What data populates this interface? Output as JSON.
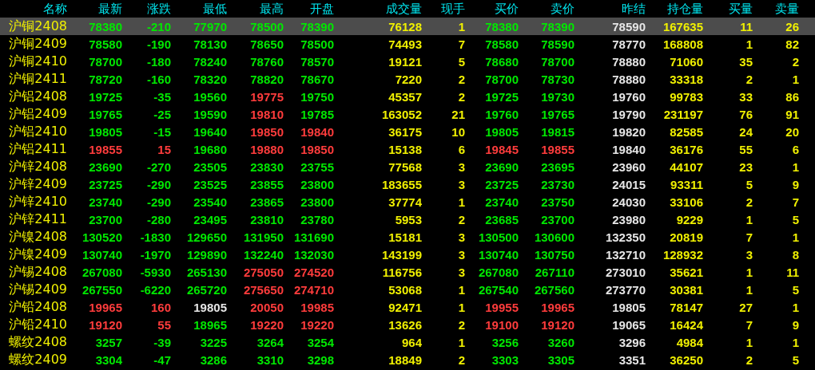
{
  "columns": [
    "名称",
    "最新",
    "涨跌",
    "最低",
    "最高",
    "开盘",
    "成交量",
    "现手",
    "买价",
    "卖价",
    "昨结",
    "持仓量",
    "买量",
    "卖量"
  ],
  "rows": [
    {
      "selected": true,
      "cells": [
        "沪铜2408",
        "78380",
        "-210",
        "77970",
        "78500",
        "78390",
        "76128",
        "1",
        "78380",
        "78390",
        "78590",
        "167635",
        "11",
        "26"
      ]
    },
    {
      "selected": false,
      "cells": [
        "沪铜2409",
        "78580",
        "-190",
        "78130",
        "78650",
        "78500",
        "74493",
        "7",
        "78580",
        "78590",
        "78770",
        "168808",
        "1",
        "82"
      ]
    },
    {
      "selected": false,
      "cells": [
        "沪铜2410",
        "78700",
        "-180",
        "78240",
        "78760",
        "78570",
        "19121",
        "5",
        "78680",
        "78700",
        "78880",
        "71060",
        "35",
        "2"
      ]
    },
    {
      "selected": false,
      "cells": [
        "沪铜2411",
        "78720",
        "-160",
        "78320",
        "78820",
        "78670",
        "7220",
        "2",
        "78700",
        "78730",
        "78880",
        "33318",
        "2",
        "1"
      ]
    },
    {
      "selected": false,
      "cells": [
        "沪铝2408",
        "19725",
        "-35",
        "19560",
        "19775",
        "19750",
        "45357",
        "2",
        "19725",
        "19730",
        "19760",
        "99783",
        "33",
        "86"
      ]
    },
    {
      "selected": false,
      "cells": [
        "沪铝2409",
        "19765",
        "-25",
        "19590",
        "19810",
        "19785",
        "163052",
        "21",
        "19760",
        "19765",
        "19790",
        "231197",
        "76",
        "91"
      ]
    },
    {
      "selected": false,
      "cells": [
        "沪铝2410",
        "19805",
        "-15",
        "19640",
        "19850",
        "19840",
        "36175",
        "10",
        "19805",
        "19815",
        "19820",
        "82585",
        "24",
        "20"
      ]
    },
    {
      "selected": false,
      "cells": [
        "沪铝2411",
        "19855",
        "15",
        "19680",
        "19880",
        "19850",
        "15138",
        "6",
        "19845",
        "19855",
        "19840",
        "36176",
        "55",
        "6"
      ]
    },
    {
      "selected": false,
      "cells": [
        "沪锌2408",
        "23690",
        "-270",
        "23505",
        "23830",
        "23755",
        "77568",
        "3",
        "23690",
        "23695",
        "23960",
        "44107",
        "23",
        "1"
      ]
    },
    {
      "selected": false,
      "cells": [
        "沪锌2409",
        "23725",
        "-290",
        "23525",
        "23855",
        "23800",
        "183655",
        "3",
        "23725",
        "23730",
        "24015",
        "93311",
        "5",
        "9"
      ]
    },
    {
      "selected": false,
      "cells": [
        "沪锌2410",
        "23740",
        "-290",
        "23540",
        "23865",
        "23800",
        "37774",
        "1",
        "23740",
        "23750",
        "24030",
        "33106",
        "2",
        "7"
      ]
    },
    {
      "selected": false,
      "cells": [
        "沪锌2411",
        "23700",
        "-280",
        "23495",
        "23810",
        "23780",
        "5953",
        "2",
        "23685",
        "23700",
        "23980",
        "9229",
        "1",
        "5"
      ]
    },
    {
      "selected": false,
      "cells": [
        "沪镍2408",
        "130520",
        "-1830",
        "129650",
        "131950",
        "131690",
        "15181",
        "3",
        "130500",
        "130600",
        "132350",
        "20819",
        "7",
        "1"
      ]
    },
    {
      "selected": false,
      "cells": [
        "沪镍2409",
        "130740",
        "-1970",
        "129890",
        "132240",
        "132030",
        "143199",
        "3",
        "130740",
        "130750",
        "132710",
        "128932",
        "3",
        "8"
      ]
    },
    {
      "selected": false,
      "cells": [
        "沪锡2408",
        "267080",
        "-5930",
        "265130",
        "275050",
        "274520",
        "116756",
        "3",
        "267080",
        "267110",
        "273010",
        "35621",
        "1",
        "11"
      ]
    },
    {
      "selected": false,
      "cells": [
        "沪锡2409",
        "267550",
        "-6220",
        "265720",
        "275650",
        "274710",
        "53068",
        "1",
        "267540",
        "267560",
        "273770",
        "30381",
        "1",
        "5"
      ]
    },
    {
      "selected": false,
      "cells": [
        "沪铅2408",
        "19965",
        "160",
        "19805",
        "20050",
        "19985",
        "92471",
        "1",
        "19955",
        "19965",
        "19805",
        "78147",
        "27",
        "1"
      ]
    },
    {
      "selected": false,
      "cells": [
        "沪铅2410",
        "19120",
        "55",
        "18965",
        "19220",
        "19220",
        "13626",
        "2",
        "19100",
        "19120",
        "19065",
        "16424",
        "7",
        "9"
      ]
    },
    {
      "selected": false,
      "cells": [
        "螺纹2408",
        "3257",
        "-39",
        "3225",
        "3264",
        "3254",
        "964",
        "1",
        "3256",
        "3260",
        "3296",
        "4984",
        "1",
        "1"
      ]
    },
    {
      "selected": false,
      "cells": [
        "螺纹2409",
        "3304",
        "-47",
        "3286",
        "3310",
        "3298",
        "18849",
        "2",
        "3303",
        "3305",
        "3351",
        "36250",
        "2",
        "5"
      ]
    }
  ]
}
